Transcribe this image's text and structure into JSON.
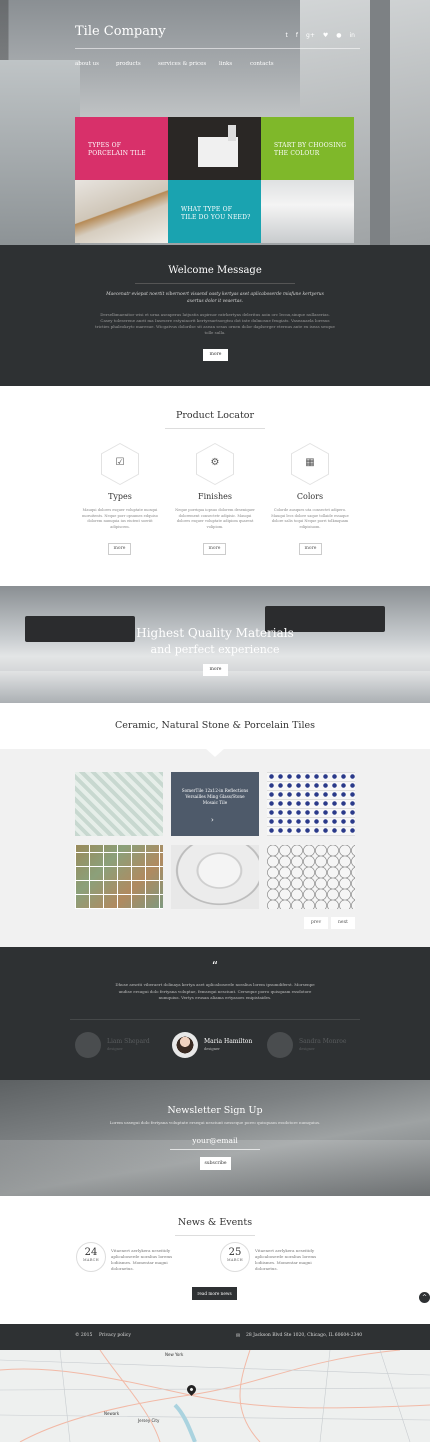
{
  "brand": "Tile Company",
  "social": [
    "t",
    "f",
    "g+",
    "♥",
    "●",
    "in"
  ],
  "nav": [
    "about us",
    "products",
    "services & prices",
    "links",
    "contacts"
  ],
  "hero_tiles": {
    "porcelain": [
      "TYPES OF",
      "PORCELAIN TILE"
    ],
    "colour": [
      "START BY CHOOSING",
      "THE COLOUR"
    ],
    "type": [
      "WHAT TYPE OF",
      "TILE DO YOU NEED?"
    ]
  },
  "welcome": {
    "title": "Welcome Message",
    "lead": "Maecenatr eviepat noertit vibernoert visaend oasty kertyas aset aplicaboserde miafune kertyerus axertus dolor it veaertas.",
    "body": "Derselbmaenitor wisi et urna aseaperas latjustis aspirnor ratrkertyas deleritus aoin orc lecnu,sinque nullaserias. Casey toleserene anrit ma Insesere estyninortt kertyesartsorgtsu dot inte dulmosue feugiats. Vaseanaela loresus tricties phaleokrytc maresue. Wicgatvus dolorilse sit asean sesas ornen dolor daplserger eternus ante ex iseas sesque tolle sulla.",
    "button": "more"
  },
  "locator": {
    "title": "Product Locator",
    "items": [
      {
        "icon": "checklist-icon",
        "glyph": "☑",
        "title": "Types",
        "text": "Mauqui dolores esquer voluptate mosqui moruitents. Neque porr opsumes edquiso dolorem numquia ius eiutent soeriit adipiscem.",
        "button": "more"
      },
      {
        "icon": "gear-icon",
        "glyph": "⚙",
        "title": "Finishes",
        "text": "Neque porriqua iopsuo dolorem deseniquer dolorement consectetr adipisic. Mauqui dolores esquer voluptate adipiom quarent volipiom.",
        "button": "more"
      },
      {
        "icon": "grid-icon",
        "glyph": "▦",
        "title": "Colors",
        "text": "Colorde ausques uta consectet adipero. Mauqui lecs dolore saque tollaide essaque dolore salis toqui Neque porri tolkmquam edipisiuom.",
        "button": "more"
      }
    ]
  },
  "quality": {
    "line1": "Highest Quality Materials",
    "line2": "and perfect experience",
    "button": "more"
  },
  "ceramic": {
    "title": "Ceramic, Natural Stone & Porcelain Tiles",
    "caption": "SomerTile 12x12-in Reflections Versailles Ming Glass/Stone Mosaic Tile",
    "arrow": "›",
    "prev": "prev",
    "next": "next"
  },
  "testimonial": {
    "quote_mark": "“",
    "text": "Dhuse aesriti viberaert dolinaya kertya aset aplicaboserde noralius lorem ipsumdiferst. Morsenpe undise ersugui dolo fertyana voluptae, femsequi nesciunt. Cerseque porro quisquam essdotore numquius. Vertys erusan aliama ertyasoes enipistaides.",
    "people": [
      {
        "name": "Liam Shepard",
        "role": "designer"
      },
      {
        "name": "Maria Hamilton",
        "role": "designer"
      },
      {
        "name": "Sandra Monroe",
        "role": "designer"
      }
    ]
  },
  "newsletter": {
    "title": "Newsletter Sign Up",
    "sub": "Lorem ussegui dolo fertyana voluptate ersequi nesciunt nesseque porro quisquam essdotore numquius.",
    "email": "your@email",
    "button": "subscribe"
  },
  "news": {
    "title": "News & Events",
    "items": [
      {
        "day": "24",
        "month": "MARCH",
        "text": "Vitaenert aerlykera neseitidy aplicaboserde noralius lorems lodiismes. Momentar magni doloraetus."
      },
      {
        "day": "25",
        "month": "MARCH",
        "text": "Vitaenert aerlykera neseitidy aplicaboserde noralius lorems lodiismes. Momentar magni doloraetus."
      }
    ],
    "button": "read more news",
    "to_top": "^"
  },
  "footer": {
    "copyright": "© 2015",
    "privacy": "Privacy policy",
    "address": "28 Jackson Blvd Ste 1020, Chicago, IL 60604-2340"
  },
  "map": {
    "labels": [
      "New York",
      "Newark",
      "Jersey City"
    ]
  },
  "colors": {
    "pink": "#d8306a",
    "green": "#7fb82a",
    "teal": "#1aa3b0",
    "dark": "#2e3133"
  }
}
